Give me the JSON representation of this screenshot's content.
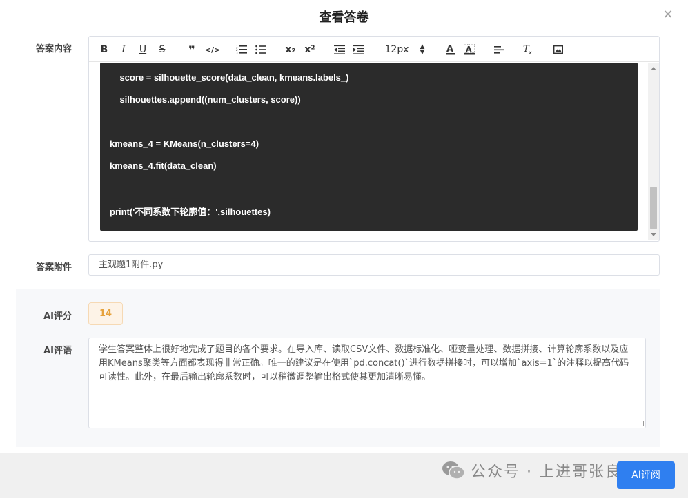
{
  "dialog": {
    "title": "查看答卷"
  },
  "labels": {
    "answer_content": "答案内容",
    "answer_attachment": "答案附件",
    "ai_score": "AI评分",
    "ai_comment": "AI评语"
  },
  "toolbar": {
    "bold": "B",
    "italic": "I",
    "underline": "U",
    "strike": "S",
    "quote": "❞",
    "code": "</>",
    "subscript": "x₂",
    "superscript": "x²",
    "font_size": "12px"
  },
  "code_lines": [
    "    score = silhouette_score(data_clean, kmeans.labels_)",
    "    silhouettes.append((num_clusters, score))",
    "",
    "kmeans_4 = KMeans(n_clusters=4)",
    "kmeans_4.fit(data_clean)",
    "",
    "print('不同系数下轮廓值：',silhouettes)"
  ],
  "attachment": {
    "filename": "主观题1附件.py"
  },
  "ai": {
    "score": "14",
    "comment": "学生答案整体上很好地完成了题目的各个要求。在导入库、读取CSV文件、数据标准化、哑变量处理、数据拼接、计算轮廓系数以及应用KMeans聚类等方面都表现得非常正确。唯一的建议是在使用`pd.concat()`进行数据拼接时，可以增加`axis=1`的注释以提高代码可读性。此外，在最后输出轮廓系数时，可以稍微调整输出格式使其更加清晰易懂。"
  },
  "footer": {
    "watermark": "公众号 · 上进哥张良均",
    "ai_button": "AI评阅"
  },
  "colors": {
    "code_bg": "#2b2b2b",
    "score_text": "#e6a23c",
    "primary": "#2f7ff0"
  }
}
